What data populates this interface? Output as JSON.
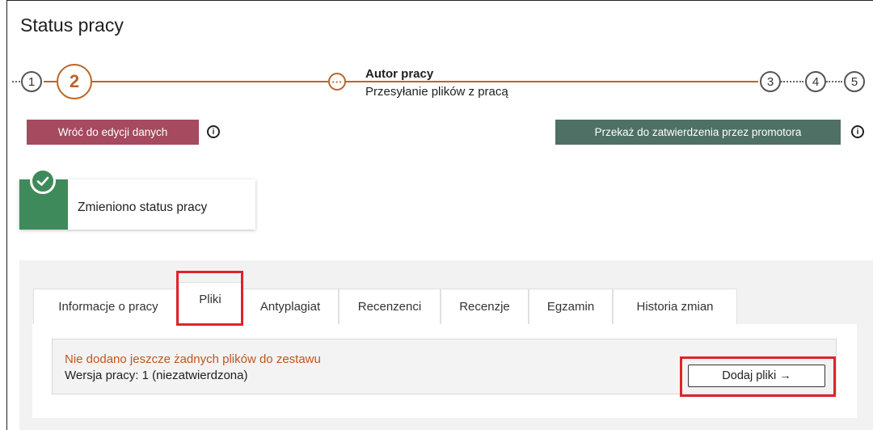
{
  "page": {
    "title": "Status pracy"
  },
  "stepper": {
    "steps": [
      "1",
      "2",
      "3",
      "4",
      "5"
    ],
    "current_label_title": "Autor pracy",
    "current_label_sub": "Przesyłanie plików z pracą",
    "substep_icon": "ellipsis-icon",
    "accent_color": "#b8652a"
  },
  "actions": {
    "back_label": "Wróć do edycji danych",
    "back_color": "#a54a5f",
    "forward_label": "Przekaż do zatwierdzenia przez promotora",
    "forward_color": "#4e7065",
    "info_icon": "info-icon"
  },
  "notice": {
    "icon": "checkmark-icon",
    "text": "Zmieniono status pracy",
    "color": "#3f8a5a"
  },
  "tabs": {
    "items": [
      "Informacje o pracy",
      "Pliki",
      "Antyplagiat",
      "Recenzenci",
      "Recenzje",
      "Egzamin",
      "Historia zmian"
    ],
    "active": "Pliki"
  },
  "files": {
    "warning": "Nie dodano jeszcze żadnych plików do zestawu",
    "version": "Wersja pracy: 1 (niezatwierdzona)",
    "add_button": "Dodaj pliki →",
    "warning_color": "#c0561b"
  },
  "highlight_color": "#e0232b"
}
